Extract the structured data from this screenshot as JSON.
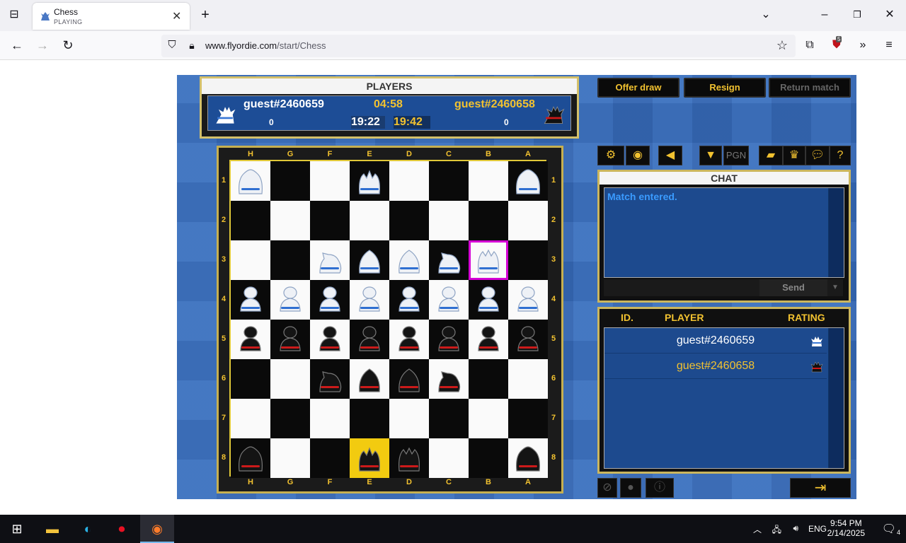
{
  "browser": {
    "tab_title": "Chess",
    "tab_subtitle": "PLAYING",
    "url_domain": "www.flyordie.com",
    "url_path": "/start/Chess",
    "extension_badge": "5"
  },
  "game": {
    "players_title": "PLAYERS",
    "white_player": "guest#2460659",
    "black_player": "guest#2460658",
    "white_move_time": "04:58",
    "white_total_time": "19:22",
    "black_total_time": "19:42",
    "white_score": "0",
    "black_score": "0",
    "buttons": {
      "offer_draw": "Offer draw",
      "resign": "Resign",
      "return_match": "Return match"
    },
    "pgn_label": "PGN",
    "board_files_top": [
      "H",
      "G",
      "F",
      "E",
      "D",
      "C",
      "B",
      "A"
    ],
    "board_ranks": [
      "1",
      "2",
      "3",
      "4",
      "5",
      "6",
      "7",
      "8"
    ],
    "board": [
      [
        "wq",
        "",
        "",
        "wk",
        "",
        "",
        "",
        "wq"
      ],
      [
        "",
        "",
        "",
        "",
        "",
        "",
        "",
        ""
      ],
      [
        "",
        "",
        "wn",
        "wb",
        "wb",
        "wn",
        "wr",
        ""
      ],
      [
        "wp",
        "wp",
        "wp",
        "wp",
        "wp",
        "wp",
        "wp",
        "wp"
      ],
      [
        "bp",
        "bp",
        "bp",
        "bp",
        "bp",
        "bp",
        "bp",
        "bp"
      ],
      [
        "",
        "",
        "bn",
        "bb",
        "bb",
        "bn",
        "",
        ""
      ],
      [
        "",
        "",
        "",
        "",
        "",
        "",
        "",
        ""
      ],
      [
        "bq",
        "",
        "",
        "bk",
        "br",
        "",
        "",
        "bq"
      ]
    ],
    "selected_square": "B3",
    "highlight_square": "E8",
    "chat": {
      "title": "CHAT",
      "message": "Match entered.",
      "send_label": "Send"
    },
    "player_list": {
      "headers": {
        "id": "ID.",
        "player": "PLAYER",
        "rating": "RATING"
      },
      "rows": [
        {
          "name": "guest#2460659",
          "color": "#ffffff"
        },
        {
          "name": "guest#2460658",
          "color": "#f2c230"
        }
      ]
    }
  },
  "taskbar": {
    "lang": "ENG",
    "time": "9:54 PM",
    "date": "2/14/2025",
    "notif_count": "4"
  }
}
